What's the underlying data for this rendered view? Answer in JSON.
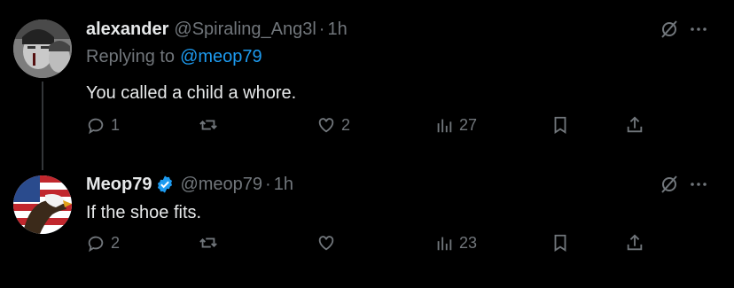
{
  "tweets": [
    {
      "author_name": "alexander",
      "author_handle": "@Spiraling_Ang3l",
      "time": "1h",
      "reply_prefix": "Replying to",
      "reply_mention": "@meop79",
      "text": "You called a child a whore.",
      "replies": "1",
      "reposts": "",
      "likes": "2",
      "views": "27"
    },
    {
      "author_name": "Meop79",
      "author_handle": "@meop79",
      "time": "1h",
      "verified": true,
      "text": "If the shoe fits.",
      "replies": "2",
      "reposts": "",
      "likes": "",
      "views": "23"
    }
  ],
  "separator": "·",
  "colors": {
    "background": "#000000",
    "text": "#e7e9ea",
    "muted": "#71767b",
    "link": "#1d9bf0",
    "verified": "#1d9bf0"
  }
}
